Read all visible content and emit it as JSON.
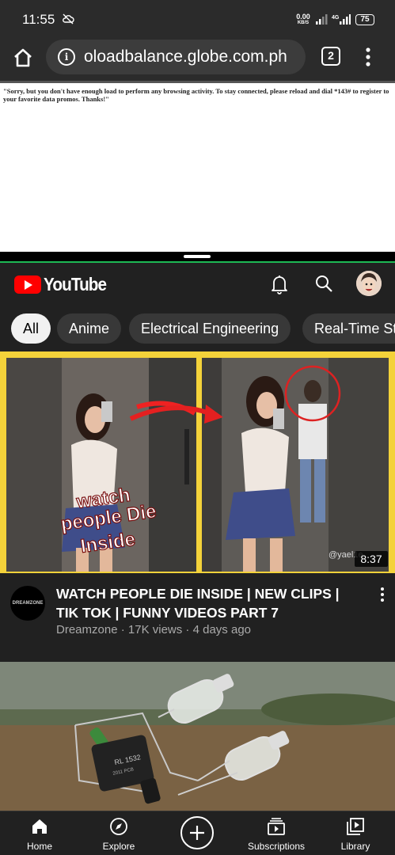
{
  "status_bar": {
    "time": "11:55",
    "net_speed_value": "0.00",
    "net_speed_unit": "KB/S",
    "network_type": "4G",
    "battery": "75"
  },
  "browser": {
    "url": "oloadbalance.globe.com.ph",
    "tab_count": "2"
  },
  "webpage": {
    "message": "\"Sorry, but you don't have enough load to perform any browsing activity. To stay connected, please reload and dial *143# to register to your favorite data promos. Thanks!\""
  },
  "youtube": {
    "logo_text": "YouTube",
    "chips": [
      {
        "label": "All",
        "active": true
      },
      {
        "label": "Anime",
        "active": false
      },
      {
        "label": "Electrical Engineering",
        "active": false
      },
      {
        "label": "Real-Time St",
        "active": false
      }
    ],
    "video1": {
      "thumbnail_caption": "watch people Die Inside",
      "watermark": "@yael1e",
      "duration": "8:37",
      "channel_avatar_text": "DREAMZONE",
      "title": "WATCH PEOPLE DIE INSIDE | NEW CLIPS | TIK TOK | FUNNY VIDEOS PART 7",
      "channel": "Dreamzone",
      "views": "17K views",
      "age": "4 days ago",
      "separator": " · "
    },
    "video2": {
      "component_label": "RL 1532",
      "component_code": "2011 PCB"
    },
    "nav": {
      "home": "Home",
      "explore": "Explore",
      "subscriptions": "Subscriptions",
      "library": "Library"
    },
    "colors": {
      "brand_red": "#ff0000",
      "thumbnail_frame": "#f4d23a",
      "background": "#212121"
    }
  }
}
